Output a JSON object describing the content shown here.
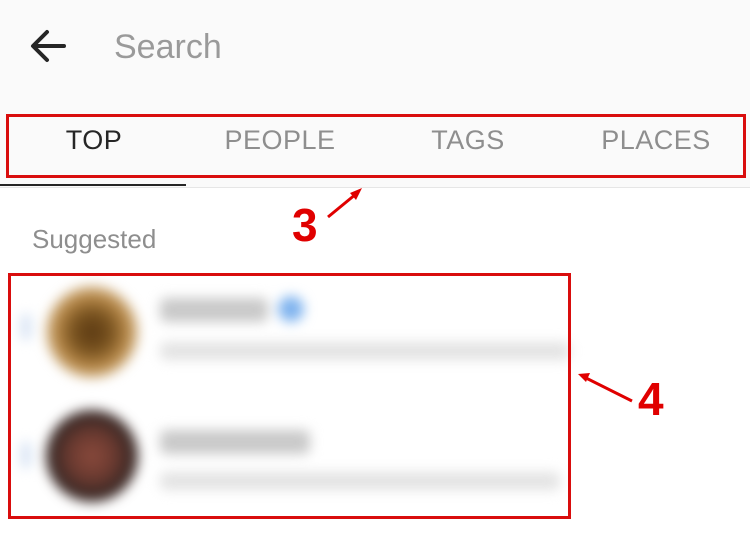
{
  "search": {
    "placeholder": "Search"
  },
  "tabs": [
    {
      "label": "TOP",
      "active": true
    },
    {
      "label": "PEOPLE",
      "active": false
    },
    {
      "label": "TAGS",
      "active": false
    },
    {
      "label": "PLACES",
      "active": false
    }
  ],
  "suggested": {
    "title": "Suggested",
    "items": [
      {
        "verified": true
      },
      {
        "verified": false
      }
    ]
  },
  "annotations": {
    "tabs_marker": "3",
    "suggestions_marker": "4"
  },
  "colors": {
    "annotation": "#d90d0d",
    "accent": "#262626",
    "muted": "#8e8e8e",
    "verified": "#3897f0"
  },
  "icons": {
    "back": "arrow-left-icon",
    "verified": "verified-badge-icon"
  }
}
